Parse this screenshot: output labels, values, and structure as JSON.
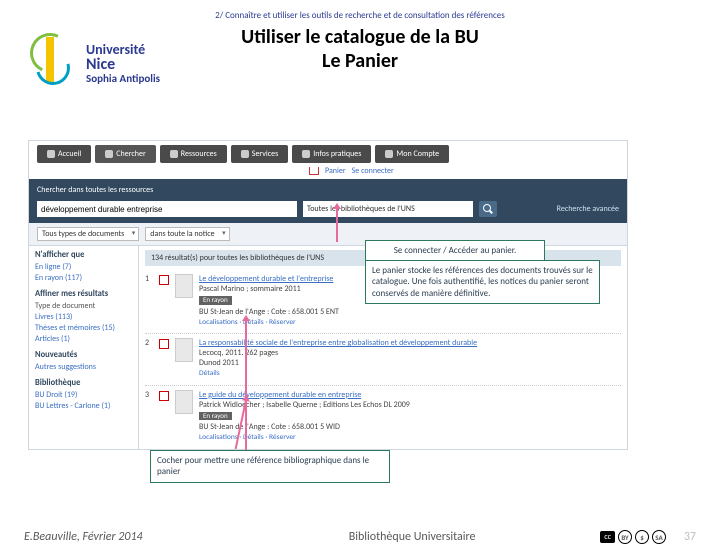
{
  "logo": {
    "line1": "Université",
    "line2": "Nice",
    "line3": "Sophia Antipolis"
  },
  "breadcrumb": "2/ Connaître et utiliser les outils de recherche et de consultation des références",
  "title_line1": "Utiliser le catalogue de la BU",
  "title_line2": "Le Panier",
  "tabs": {
    "accueil": "Accueil",
    "chercher": "Chercher",
    "ressources": "Ressources",
    "services": "Services",
    "infos": "Infos pratiques",
    "compte": "Mon Compte"
  },
  "panier": {
    "label": "Panier",
    "signin": "Se connecter"
  },
  "search": {
    "label": "Chercher dans toutes les ressources",
    "query": "développement durable entreprise",
    "scope": "Toutes les bibliothèques de l'UNS",
    "advanced": "Recherche avancée",
    "type": "Tous types de documents",
    "where": "dans toute la notice"
  },
  "sidebar": {
    "narrow": "N'afficher que",
    "online": "En ligne (7)",
    "shelf": "En rayon (117)",
    "refine": "Affiner mes résultats",
    "doctype": "Type de document",
    "livres": "Livres (113)",
    "theses": "Thèses et mémoires (15)",
    "articles": "Articles (1)",
    "nouv": "Nouveautés",
    "nouv1": "Autres suggestions",
    "biblio": "Bibliothèque",
    "b1": "BU Droit (19)",
    "b2": "BU Lettres - Carlone (1)"
  },
  "results": {
    "count": "134 résultat(s) pour toutes les bibliothèques de l'UNS",
    "items": [
      {
        "title": "Le développement durable et l'entreprise",
        "author": "Pascal Marino ; sommaire 2011",
        "location": "BU St-Jean de l'Ange : Cote : 658.001 5 ENT",
        "badge": "En rayon",
        "links": "Localisations · Détails · Réserver"
      },
      {
        "title": "La responsabilité sociale de l'entreprise entre globalisation et développement durable",
        "author": "Lecocq, 2011. 262 pages",
        "location": "Dunod 2011",
        "badge": "",
        "links": "Détails"
      },
      {
        "title": "Le guide du développement durable en entreprise",
        "author": "Patrick Widloecher ; Isabelle Querne ; Editions Les Echos DL 2009",
        "location": "BU St-Jean de l'Ange : Cote : 658.001 5 WID",
        "badge": "En rayon",
        "links": "Localisations · Détails · Réserver"
      }
    ]
  },
  "callouts": {
    "c1": "Se connecter / Accéder au panier.",
    "c2": "Le panier stocke les références des documents trouvés sur le catalogue. Une fois authentifié, les notices du panier seront conservés de manière définitive.",
    "c3": "Cocher pour mettre une référence bibliographique dans le panier"
  },
  "footer": {
    "author": "E.Beauville, Février 2014",
    "center": "Bibliothèque Universitaire",
    "cc_by": "BY",
    "cc_sa": "SA",
    "page": "37"
  }
}
